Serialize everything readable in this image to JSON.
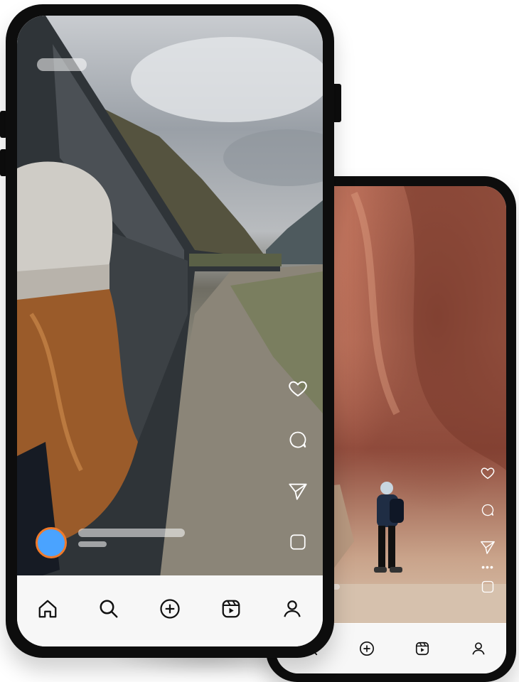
{
  "front_phone": {
    "screen": "reels-feed",
    "post": {
      "scene": "train-along-mountain",
      "actions": [
        {
          "name": "like",
          "icon": "heart-icon"
        },
        {
          "name": "comment",
          "icon": "comment-icon"
        },
        {
          "name": "share",
          "icon": "send-icon"
        },
        {
          "name": "save",
          "icon": "bookmark-icon"
        }
      ]
    },
    "tab_bar": [
      {
        "name": "home",
        "icon": "home-icon",
        "active": true
      },
      {
        "name": "search",
        "icon": "search-icon"
      },
      {
        "name": "create",
        "icon": "add-icon"
      },
      {
        "name": "reels",
        "icon": "reels-icon"
      },
      {
        "name": "profile",
        "icon": "profile-icon"
      }
    ]
  },
  "back_phone": {
    "screen": "reels-feed",
    "post": {
      "scene": "slot-canyon-hiker",
      "actions": [
        {
          "name": "like",
          "icon": "heart-icon"
        },
        {
          "name": "comment",
          "icon": "comment-icon"
        },
        {
          "name": "share",
          "icon": "send-icon"
        },
        {
          "name": "more",
          "icon": "more-icon"
        },
        {
          "name": "save",
          "icon": "bookmark-icon"
        }
      ]
    },
    "tab_bar": [
      {
        "name": "search",
        "icon": "search-icon"
      },
      {
        "name": "create",
        "icon": "add-icon"
      },
      {
        "name": "reels",
        "icon": "reels-icon"
      },
      {
        "name": "profile",
        "icon": "profile-icon"
      }
    ]
  },
  "colors": {
    "avatar_fill": "#4aa3ff",
    "avatar_ring": "#f07a2a",
    "tab_bar_bg": "#f7f7f7",
    "phone_frame": "#0d0d0d"
  }
}
